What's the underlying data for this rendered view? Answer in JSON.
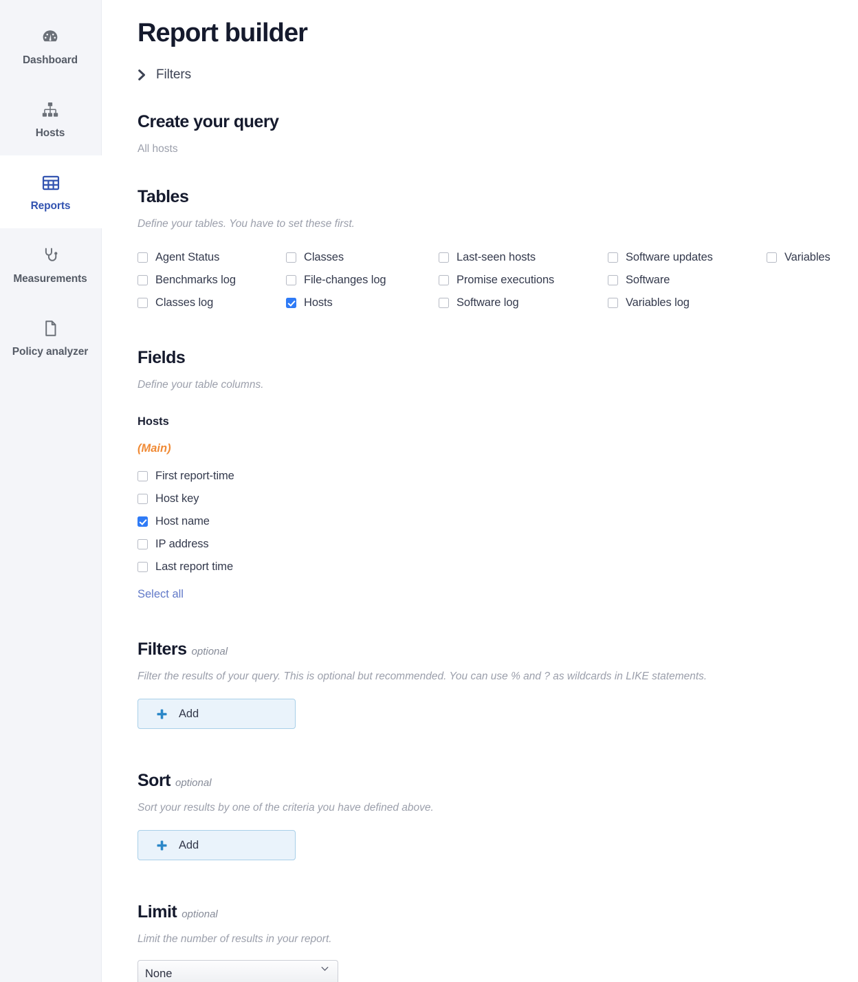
{
  "sidebar": {
    "items": [
      {
        "label": "Dashboard",
        "icon": "gauge-icon",
        "active": false
      },
      {
        "label": "Hosts",
        "icon": "hierarchy-icon",
        "active": false
      },
      {
        "label": "Reports",
        "icon": "table-grid-icon",
        "active": true
      },
      {
        "label": "Measurements",
        "icon": "stethoscope-icon",
        "active": false
      },
      {
        "label": "Policy analyzer",
        "icon": "document-page-icon",
        "active": false
      }
    ],
    "active_color": "#3253b0",
    "background": "#f4f5f9"
  },
  "header": {
    "title": "Report builder",
    "filters_toggle": {
      "label": "Filters",
      "icon": "chevron-right-icon",
      "expanded": false
    }
  },
  "query": {
    "title": "Create your query",
    "scope": "All hosts"
  },
  "tables": {
    "title": "Tables",
    "description": "Define your tables. You have to set these first.",
    "columns": [
      [
        {
          "label": "Agent Status",
          "checked": false
        },
        {
          "label": "Benchmarks log",
          "checked": false
        },
        {
          "label": "Classes log",
          "checked": false
        }
      ],
      [
        {
          "label": "Classes",
          "checked": false
        },
        {
          "label": "File-changes log",
          "checked": false
        },
        {
          "label": "Hosts",
          "checked": true
        }
      ],
      [
        {
          "label": "Last-seen hosts",
          "checked": false
        },
        {
          "label": "Promise executions",
          "checked": false
        },
        {
          "label": "Software log",
          "checked": false
        }
      ],
      [
        {
          "label": "Software updates",
          "checked": false
        },
        {
          "label": "Software",
          "checked": false
        },
        {
          "label": "Variables log",
          "checked": false
        }
      ],
      [
        {
          "label": "Variables",
          "checked": false
        }
      ]
    ]
  },
  "fields": {
    "title": "Fields",
    "description": "Define your table columns.",
    "table_name": "Hosts",
    "main_tag": "(Main)",
    "main_tag_color": "#f08a35",
    "items": [
      {
        "label": "First report-time",
        "checked": false
      },
      {
        "label": "Host key",
        "checked": false
      },
      {
        "label": "Host name",
        "checked": true
      },
      {
        "label": "IP address",
        "checked": false
      },
      {
        "label": "Last report time",
        "checked": false
      }
    ],
    "select_all_label": "Select all"
  },
  "filters": {
    "title": "Filters",
    "optional_label": "optional",
    "description": "Filter the results of your query. This is optional but recommended. You can use % and ? as wildcards in LIKE statements.",
    "add_label": "Add",
    "add_icon": "plus-icon"
  },
  "sort": {
    "title": "Sort",
    "optional_label": "optional",
    "description": "Sort your results by one of the criteria you have defined above.",
    "add_label": "Add",
    "add_icon": "plus-icon"
  },
  "limit": {
    "title": "Limit",
    "optional_label": "optional",
    "description": "Limit the number of results in your report.",
    "selected": "None",
    "options": [
      "None"
    ],
    "chevron_icon": "chevron-down-icon"
  }
}
